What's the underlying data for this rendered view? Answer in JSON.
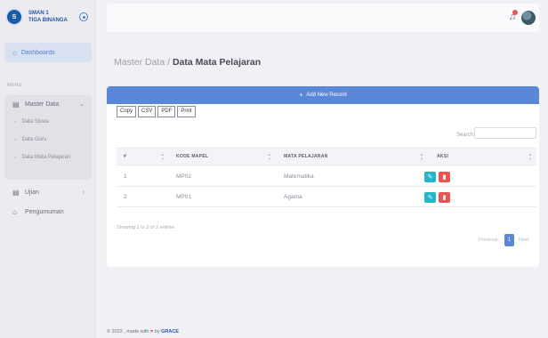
{
  "sidebar": {
    "brand_line1": "SMAN 1",
    "brand_line2": "TIGA BINANGA",
    "logo_text": "S",
    "dashboards_label": "Dashboards",
    "section_label": "MENU",
    "master_data_label": "Master Data",
    "master_data_items": [
      "Data Siswa",
      "Data Guru",
      "Data Mata Pelajaran"
    ],
    "ujian_label": "Ujian",
    "pengumuman_label": "Pengumuman",
    "icons": {
      "dashboards": "home-icon",
      "master_data": "file-icon",
      "ujian": "file-icon",
      "pengumuman": "home-icon"
    }
  },
  "header": {
    "notification_icon": "bell-icon",
    "notification_color": "#ea5455"
  },
  "breadcrumb": {
    "parent": "Master Data /",
    "current": "Data Mata Pelajaran"
  },
  "table_card": {
    "add_label": "Add New Record",
    "export_buttons": [
      "Copy",
      "CSV",
      "PDF",
      "Print"
    ],
    "search_label": "Search:",
    "search_value": "",
    "columns": [
      "#",
      "KODE MAPEL",
      "MATA PELAJARAN",
      "AKSI"
    ],
    "rows": [
      {
        "no": "1",
        "kode": "MP02",
        "mapel": "Matematika"
      },
      {
        "no": "2",
        "kode": "MP01",
        "mapel": "Agama"
      }
    ],
    "info": "Showing 1 to 2 of 2 entries",
    "pagination": {
      "previous": "Previous",
      "current": "1",
      "next": "Next"
    }
  },
  "footer": {
    "prefix": "© 2022 , made with",
    "by": "by",
    "author": "GRACE"
  },
  "colors": {
    "primary": "#5b87db",
    "edit": "#22b7c9",
    "delete": "#ea5455",
    "brand": "#1e5aa8"
  }
}
